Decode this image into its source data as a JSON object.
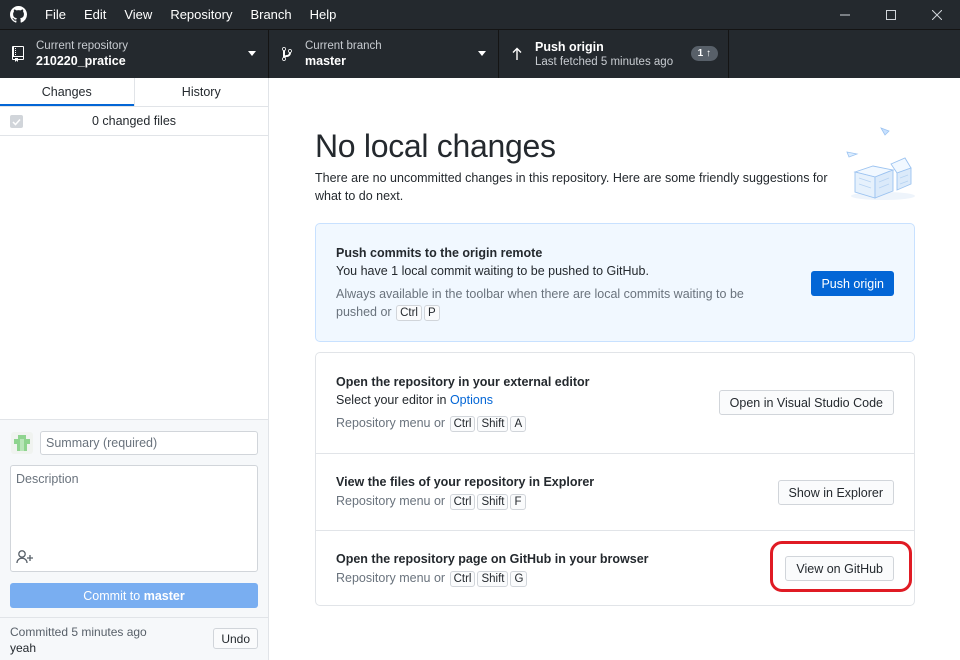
{
  "menu": [
    "File",
    "Edit",
    "View",
    "Repository",
    "Branch",
    "Help"
  ],
  "toolbar": {
    "repo_label": "Current repository",
    "repo_value": "210220_pratice",
    "branch_label": "Current branch",
    "branch_value": "master",
    "push_label": "Push origin",
    "push_sub": "Last fetched 5 minutes ago",
    "push_badge": "1 ↑"
  },
  "sidebar": {
    "tabs": [
      "Changes",
      "History"
    ],
    "changed_files": "0 changed files",
    "summary_placeholder": "Summary (required)",
    "description_placeholder": "Description",
    "commit_prefix": "Commit to ",
    "commit_branch": "master",
    "last_commit_time": "Committed 5 minutes ago",
    "last_commit_msg": "yeah",
    "undo_label": "Undo"
  },
  "main": {
    "heading": "No local changes",
    "subtitle": "There are no uncommitted changes in this repository. Here are some friendly suggestions for what to do next.",
    "push_card": {
      "title": "Push commits to the origin remote",
      "desc": "You have 1 local commit waiting to be pushed to GitHub.",
      "hint_line1": "Always available in the toolbar when there are local commits waiting to be",
      "hint_line2": "pushed or",
      "keys": [
        "Ctrl",
        "P"
      ],
      "button": "Push origin"
    },
    "actions": [
      {
        "title": "Open the repository in your external editor",
        "desc": "Select your editor in ",
        "link": "Options",
        "shortcut_prefix": "Repository menu or",
        "keys": [
          "Ctrl",
          "Shift",
          "A"
        ],
        "button": "Open in Visual Studio Code"
      },
      {
        "title": "View the files of your repository in Explorer",
        "shortcut_prefix": "Repository menu or",
        "keys": [
          "Ctrl",
          "Shift",
          "F"
        ],
        "button": "Show in Explorer"
      },
      {
        "title": "Open the repository page on GitHub in your browser",
        "shortcut_prefix": "Repository menu or",
        "keys": [
          "Ctrl",
          "Shift",
          "G"
        ],
        "button": "View on GitHub"
      }
    ]
  },
  "colors": {
    "dark_bg": "#24292e",
    "accent": "#0366d6",
    "highlight": "#e01b24",
    "push_card_bg": "#f1f8ff"
  }
}
